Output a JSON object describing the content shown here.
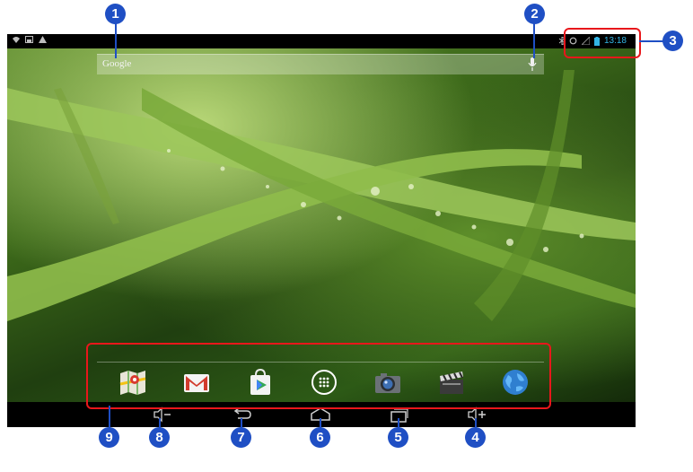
{
  "status_bar": {
    "left_icons": [
      "wifi-icon",
      "picture-icon",
      "warning-icon"
    ],
    "right_icons": [
      "bluetooth-icon",
      "sync-icon",
      "signal-icon",
      "battery-icon"
    ],
    "time": "13:18"
  },
  "search": {
    "label": "Google",
    "mic_icon": "microphone-icon"
  },
  "dock": {
    "apps": [
      {
        "name": "Maps",
        "icon": "maps-icon"
      },
      {
        "name": "Gmail",
        "icon": "gmail-icon"
      },
      {
        "name": "Play Store",
        "icon": "play-store-icon"
      },
      {
        "name": "All Apps",
        "icon": "app-drawer-icon"
      },
      {
        "name": "Camera",
        "icon": "camera-icon"
      },
      {
        "name": "Movie Studio",
        "icon": "clapper-icon"
      },
      {
        "name": "Browser",
        "icon": "globe-icon"
      }
    ]
  },
  "nav_bar": {
    "buttons": [
      {
        "name": "Volume down",
        "icon": "volume-down-icon"
      },
      {
        "name": "Back",
        "icon": "back-icon"
      },
      {
        "name": "Home",
        "icon": "home-icon"
      },
      {
        "name": "Recent apps",
        "icon": "recent-apps-icon"
      },
      {
        "name": "Volume up",
        "icon": "volume-up-icon"
      }
    ]
  },
  "callouts": {
    "c1": "1",
    "c2": "2",
    "c3": "3",
    "c4": "4",
    "c5": "5",
    "c6": "6",
    "c7": "7",
    "c8": "8",
    "c9": "9"
  },
  "colors": {
    "callout": "#1f4fc4",
    "highlight": "#e8171b",
    "clock": "#33b5e5"
  }
}
